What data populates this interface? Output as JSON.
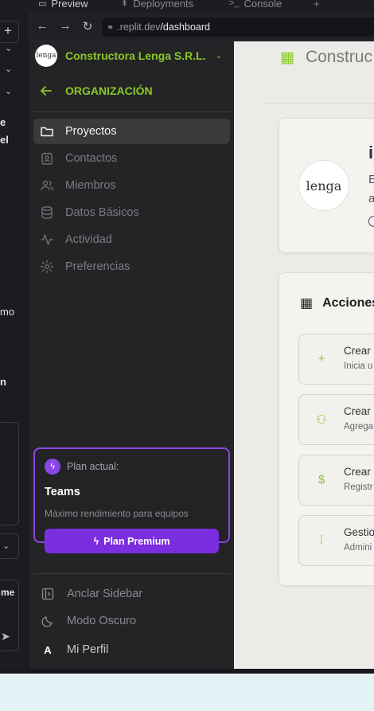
{
  "browser": {
    "tabs": [
      {
        "label": "Preview"
      },
      {
        "label": "Deployments"
      },
      {
        "label": "Console"
      }
    ],
    "new_tab": "+",
    "url_host": ".replit.dev",
    "url_path": "/dashboard"
  },
  "ide_panel": {
    "fragments": [
      "e",
      "el",
      "mo",
      "n",
      "me"
    ]
  },
  "sidebar": {
    "company": "Constructora Lenga S.R.L.",
    "logo_text": "lenga",
    "section": "ORGANIZACIÓN",
    "items": [
      {
        "label": "Proyectos",
        "icon": "folder-icon",
        "active": true
      },
      {
        "label": "Contactos",
        "icon": "contact-icon",
        "active": false
      },
      {
        "label": "Miembros",
        "icon": "users-icon",
        "active": false
      },
      {
        "label": "Datos Básicos",
        "icon": "database-icon",
        "active": false
      },
      {
        "label": "Actividad",
        "icon": "activity-icon",
        "active": false
      },
      {
        "label": "Preferencias",
        "icon": "gear-icon",
        "active": false
      }
    ],
    "plan": {
      "label": "Plan actual:",
      "name": "Teams",
      "description": "Máximo rendimiento para equipos",
      "button": "Plan Premium"
    },
    "bottom": [
      {
        "label": "Anclar Sidebar",
        "icon": "pin-sidebar-icon"
      },
      {
        "label": "Modo Oscuro",
        "icon": "moon-icon"
      },
      {
        "label": "Mi Perfil",
        "icon": "avatar-letter",
        "letter": "A"
      }
    ]
  },
  "main": {
    "title": "Construc",
    "card": {
      "title": "i",
      "line1": "E",
      "line2": "a"
    },
    "actions": {
      "title": "Acciones",
      "items": [
        {
          "title": "Crear",
          "subtitle": "Inicia u",
          "icon": "plus-icon",
          "glyph": "+"
        },
        {
          "title": "Crear",
          "subtitle": "Agrega",
          "icon": "users-icon",
          "glyph": "⚇"
        },
        {
          "title": "Crear",
          "subtitle": "Registr",
          "icon": "dollar-icon",
          "glyph": "$"
        },
        {
          "title": "Gestio",
          "subtitle": "Admini",
          "icon": "kanban-icon",
          "glyph": "⁞"
        }
      ]
    }
  },
  "colors": {
    "accent_green": "#8ac926",
    "accent_purple": "#8b45e8",
    "sidebar_bg": "#242427",
    "main_bg": "#ecebe8"
  }
}
